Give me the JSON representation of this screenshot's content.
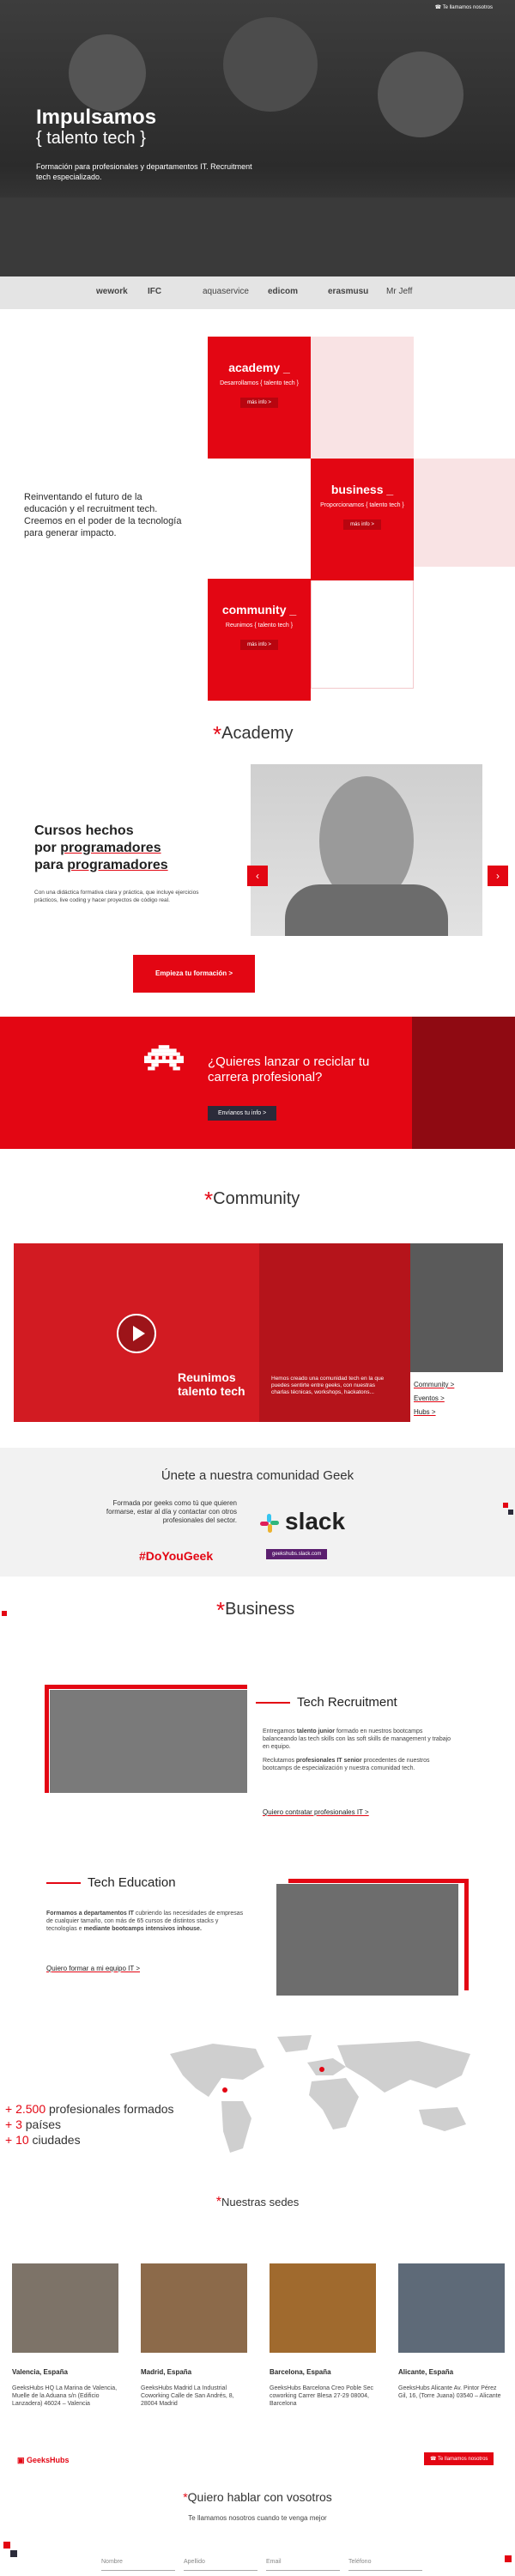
{
  "hero": {
    "call_label": "Te llamamos nosotros",
    "title": "Impulsamos",
    "subtitle": "{ talento tech }",
    "description": "Formación para profesionales y departamentos IT. Recruitment tech especializado."
  },
  "logos": [
    "wework",
    "IFC",
    "aquaservice",
    "edicom",
    "erasmusu",
    "Mr Jeff"
  ],
  "about": {
    "text": "Reinventando el futuro de la educación y el recruitment tech. Creemos en el poder de la tecnología para generar impacto.",
    "tiles": [
      {
        "title": "academy _",
        "sub": "Desarrollamos { talento tech }",
        "btn": "más info >"
      },
      {
        "title": "business _",
        "sub": "Proporcionamos { talento tech }",
        "btn": "más info >"
      },
      {
        "title": "community _",
        "sub": "Reunimos { talento tech }",
        "btn": "más info >"
      }
    ]
  },
  "academy": {
    "heading": "Academy",
    "title_l1": "Cursos hechos",
    "title_l2a": "por ",
    "title_l2b": "programadores",
    "title_l3a": "para ",
    "title_l3b": "programadores",
    "paragraph": "Con una didáctica formativa clara y práctica, que incluye ejercicios prácticos, live coding y hacer proyectos de código real.",
    "cta": "Empieza tu formación >",
    "prev": "‹",
    "next": "›"
  },
  "banner": {
    "question": "¿Quieres lanzar o reciclar tu carrera profesional?",
    "button": "Envíanos tu info >"
  },
  "community": {
    "heading": "Community",
    "title": "Reunimos talento tech",
    "text": "Hemos creado una comunidad tech en la que puedes sentirte entre geeks, con nuestras charlas técnicas, workshops, hackatons...",
    "link1": "Community >",
    "link2": "Eventos >",
    "link3": "Hubs >"
  },
  "geek": {
    "title": "Únete a nuestra comunidad Geek",
    "paragraph": "Formada por geeks como tú que quieren formarse, estar al día y contactar con otros profesionales del sector.",
    "hashtag": "#DoYouGeek",
    "slack": "slack",
    "slack_url": "geekshubs.slack.com"
  },
  "business": {
    "heading": "Business",
    "recruitment": {
      "title": "Tech Recruitment",
      "p1a": "Entregamos ",
      "p1b": "talento junior",
      "p1c": " formado en nuestros bootcamps balanceando las tech skills con las soft skills de management y trabajo en equipo.",
      "p2a": "Reclutamos ",
      "p2b": "profesionales IT senior",
      "p2c": " procedentes de nuestros bootcamps de especialización y nuestra comunidad tech.",
      "link": "Quiero contratar profesionales IT >"
    },
    "education": {
      "title": "Tech Education",
      "p1a": "Formamos a departamentos IT",
      "p1b": " cubriendo las necesidades de empresas de cualquier tamaño, con más de 65 cursos de distintos stacks y tecnologías e ",
      "p1c": "mediante bootcamps intensivos inhouse.",
      "link": "Quiero formar a mi equipo IT >"
    }
  },
  "stats": [
    {
      "prefix": "+ 2.500",
      "rest": " profesionales formados"
    },
    {
      "prefix": "+ 3",
      "rest": " países"
    },
    {
      "prefix": "+ 10",
      "rest": " ciudades"
    }
  ],
  "offices": {
    "heading": "Nuestras sedes",
    "items": [
      {
        "city": "Valencia, España",
        "addr": "GeeksHubs HQ La Marina de Valencia, Muelle de la Aduana s/n (Edificio Lanzadera) 46024 – Valencia"
      },
      {
        "city": "Madrid, España",
        "addr": "GeeksHubs Madrid La Industrial Coworking Calle de San Andrés, 8, 28004 Madrid"
      },
      {
        "city": "Barcelona, España",
        "addr": "GeeksHubs Barcelona Creo Poble Sec coworking Carrer Blesa 27-29 08004, Barcelona"
      },
      {
        "city": "Alicante, España",
        "addr": "GeeksHubs Alicante Av. Pintor Pérez Gil, 16, (Torre Juana) 03540 – Alicante"
      }
    ]
  },
  "contact": {
    "logo": "GeeksHubs",
    "call": "Te llamamos nosotros",
    "title": "Quiero hablar con vosotros",
    "sub": "Te llamamos nosotros cuando te venga mejor",
    "fields": [
      "Nombre",
      "Apellido",
      "Email",
      "Teléfono"
    ]
  },
  "colors": {
    "accent": "#e30613",
    "dark": "#2b2b3a"
  }
}
